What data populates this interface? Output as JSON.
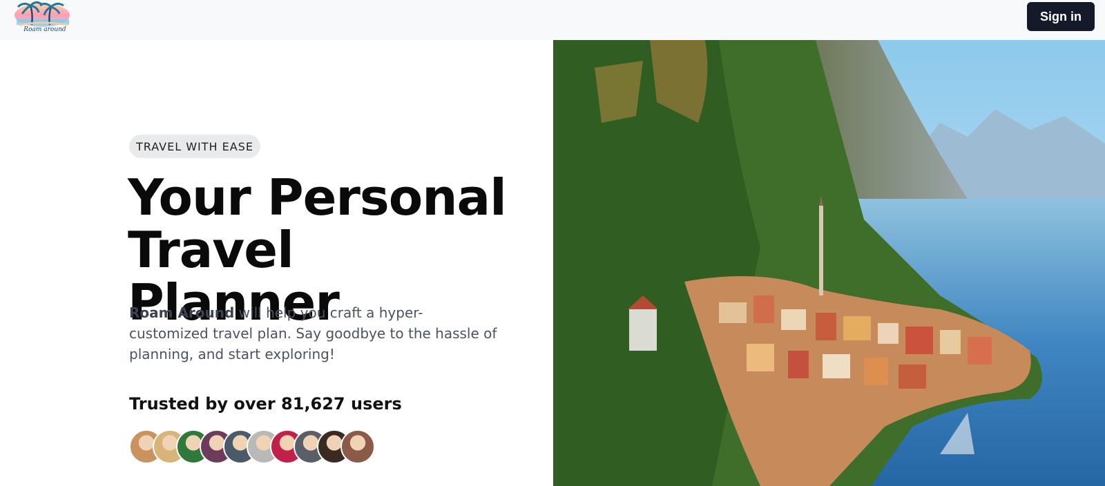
{
  "header": {
    "logo_text": "Roam around",
    "signin_label": "Sign in"
  },
  "hero": {
    "badge": "TRAVEL WITH EASE",
    "title_line1": "Your Personal",
    "title_line2": "Travel Planner",
    "desc_brand": "Roam Around",
    "desc_rest": " will help you craft a hyper-customized travel plan. Say goodbye to the hassle of planning, and start exploring!",
    "trusted": "Trusted by over 81,627 users"
  },
  "avatars": [
    {
      "name": "user-avatar-1",
      "color": "#c9925e"
    },
    {
      "name": "user-avatar-2",
      "color": "#d8b47a"
    },
    {
      "name": "user-avatar-3",
      "color": "#2f7a3a"
    },
    {
      "name": "user-avatar-4",
      "color": "#6d3c5c"
    },
    {
      "name": "user-avatar-5",
      "color": "#4a5a6a"
    },
    {
      "name": "user-avatar-6",
      "color": "#b9b9b9"
    },
    {
      "name": "user-avatar-7",
      "color": "#c0204a"
    },
    {
      "name": "user-avatar-8",
      "color": "#5a5e66"
    },
    {
      "name": "user-avatar-9",
      "color": "#3b2a22"
    },
    {
      "name": "user-avatar-10",
      "color": "#8c5a48"
    }
  ],
  "colors": {
    "header_bg": "#f8f9fb",
    "signin_bg": "#141a2a",
    "badge_bg": "#e9eaec"
  },
  "icons": {
    "logo": "palm-tree-logo-icon"
  }
}
